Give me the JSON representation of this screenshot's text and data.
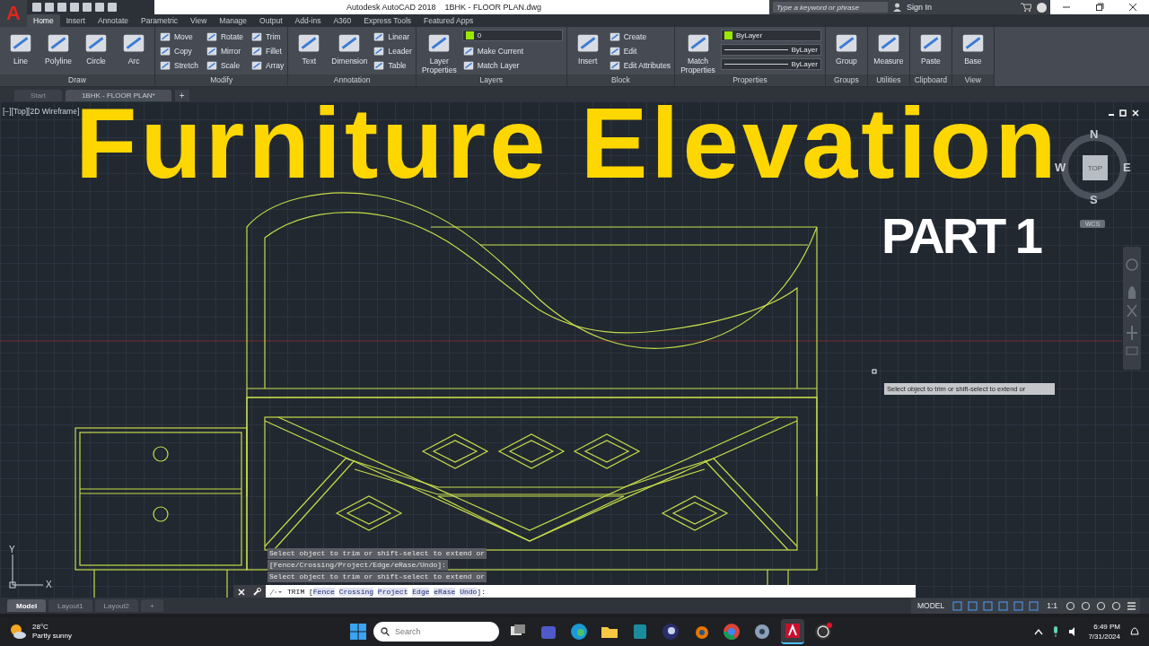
{
  "app_menu": {
    "label": "A"
  },
  "window": {
    "title": "Autodesk AutoCAD 2018    1BHK - FLOOR PLAN.dwg"
  },
  "search": {
    "placeholder": "Type a keyword or phrase"
  },
  "sign_in": "Sign In",
  "ribbon_tabs": [
    {
      "label": "Home",
      "selected": true
    },
    {
      "label": "Insert",
      "selected": false
    },
    {
      "label": "Annotate",
      "selected": false
    },
    {
      "label": "Parametric",
      "selected": false
    },
    {
      "label": "View",
      "selected": false
    },
    {
      "label": "Manage",
      "selected": false
    },
    {
      "label": "Output",
      "selected": false
    },
    {
      "label": "Add-ins",
      "selected": false
    },
    {
      "label": "A360",
      "selected": false
    },
    {
      "label": "Express Tools",
      "selected": false
    },
    {
      "label": "Featured Apps",
      "selected": false
    }
  ],
  "panels": [
    {
      "label": "Draw",
      "tools": [
        {
          "lines": [
            "Line"
          ],
          "kind": "large"
        },
        {
          "lines": [
            "Polyline"
          ],
          "kind": "large"
        },
        {
          "lines": [
            "Circle"
          ],
          "kind": "large"
        },
        {
          "lines": [
            "Arc"
          ],
          "kind": "large"
        }
      ]
    },
    {
      "label": "Modify",
      "tools": [
        {
          "lines": [
            "Move"
          ],
          "kind": "small"
        },
        {
          "lines": [
            "Copy"
          ],
          "kind": "small"
        },
        {
          "lines": [
            "Stretch"
          ],
          "kind": "small"
        },
        {
          "lines": [
            "Rotate"
          ],
          "kind": "small"
        },
        {
          "lines": [
            "Mirror"
          ],
          "kind": "small"
        },
        {
          "lines": [
            "Scale"
          ],
          "kind": "small"
        },
        {
          "lines": [
            "Trim"
          ],
          "kind": "small"
        },
        {
          "lines": [
            "Fillet"
          ],
          "kind": "small"
        },
        {
          "lines": [
            "Array"
          ],
          "kind": "small"
        }
      ]
    },
    {
      "label": "Annotation",
      "tools": [
        {
          "lines": [
            "Text"
          ],
          "kind": "large"
        },
        {
          "lines": [
            "Dimension"
          ],
          "kind": "large"
        },
        {
          "lines": [
            "Linear"
          ],
          "kind": "small"
        },
        {
          "lines": [
            "Leader"
          ],
          "kind": "small"
        },
        {
          "lines": [
            "Table"
          ],
          "kind": "small"
        }
      ]
    },
    {
      "label": "Layers",
      "tools": [
        {
          "lines": [
            "Layer",
            "Properties"
          ],
          "kind": "large"
        },
        {
          "lines": [
            "0"
          ],
          "kind": "dropdown"
        },
        {
          "lines": [
            "Make Current"
          ],
          "kind": "small"
        },
        {
          "lines": [
            "Match Layer"
          ],
          "kind": "small"
        }
      ]
    },
    {
      "label": "Block",
      "tools": [
        {
          "lines": [
            "Insert"
          ],
          "kind": "large"
        },
        {
          "lines": [
            "Create"
          ],
          "kind": "small"
        },
        {
          "lines": [
            "Edit"
          ],
          "kind": "small"
        },
        {
          "lines": [
            "Edit Attributes"
          ],
          "kind": "small"
        }
      ]
    },
    {
      "label": "Properties",
      "tools": [
        {
          "lines": [
            "Match",
            "Properties"
          ],
          "kind": "large"
        },
        {
          "lines": [
            "ByLayer"
          ],
          "kind": "dropdown"
        },
        {
          "lines": [
            "ByLayer"
          ],
          "kind": "dropdown"
        },
        {
          "lines": [
            "ByLayer"
          ],
          "kind": "dropdown"
        }
      ]
    },
    {
      "label": "Groups",
      "tools": [
        {
          "lines": [
            "Group"
          ],
          "kind": "large"
        }
      ]
    },
    {
      "label": "Utilities",
      "tools": [
        {
          "lines": [
            "Measure"
          ],
          "kind": "large"
        }
      ]
    },
    {
      "label": "Clipboard",
      "tools": [
        {
          "lines": [
            "Paste"
          ],
          "kind": "large"
        }
      ]
    },
    {
      "label": "View",
      "tools": [
        {
          "lines": [
            "Base"
          ],
          "kind": "large"
        }
      ]
    }
  ],
  "doc_tabs": [
    {
      "label": "Start",
      "selected": false
    },
    {
      "label": "1BHK - FLOOR PLAN*",
      "selected": true
    }
  ],
  "new_doc_tab": "+",
  "viewport_label": "[−][Top][2D Wireframe]",
  "overlay": {
    "title": "Furniture Elevation",
    "subtitle": "PART 1"
  },
  "viewcube": {
    "top": "TOP",
    "north": "N",
    "south": "S",
    "east": "E",
    "west": "W",
    "ucs": "WCS"
  },
  "ucs_icon": {
    "x": "X",
    "y": "Y"
  },
  "tooltip": "Select object to trim or shift-select to extend or",
  "command_history": [
    "Select object to trim or shift-select to extend or",
    "[Fence/Crossing/Project/Edge/eRase/Undo]:",
    "Select object to trim or shift-select to extend or"
  ],
  "command_line": {
    "prefix": "TRIM [",
    "options": [
      "Fence",
      "Crossing",
      "Project",
      "Edge",
      "eRase",
      "Undo"
    ],
    "suffix": "]:"
  },
  "layout_tabs": [
    {
      "label": "Model",
      "selected": true
    },
    {
      "label": "Layout1",
      "selected": false
    },
    {
      "label": "Layout2",
      "selected": false
    }
  ],
  "new_layout_tab": "+",
  "status_bar": {
    "space": "MODEL",
    "scale": "1:1"
  },
  "taskbar": {
    "temperature": "28°C",
    "weather": "Partly sunny",
    "search_placeholder": "Search",
    "apps": [
      {
        "kind": "taskview",
        "selected": false
      },
      {
        "kind": "chat",
        "selected": false
      },
      {
        "kind": "edge",
        "selected": false
      },
      {
        "kind": "folder",
        "selected": false
      },
      {
        "kind": "max",
        "selected": false
      },
      {
        "kind": "cinema",
        "selected": false
      },
      {
        "kind": "blender",
        "selected": false
      },
      {
        "kind": "chrome",
        "selected": false
      },
      {
        "kind": "gear",
        "selected": false
      },
      {
        "kind": "autocad",
        "selected": true
      },
      {
        "kind": "obs",
        "selected": false
      }
    ],
    "time": "6:49 PM",
    "date": "7/31/2024"
  }
}
